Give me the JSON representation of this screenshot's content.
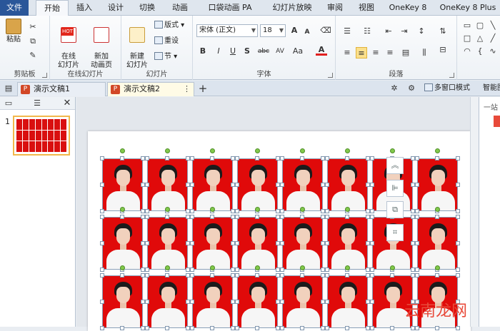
{
  "menu": {
    "tabs": [
      "文件",
      "开始",
      "插入",
      "设计",
      "切换",
      "动画",
      "口袋动画 PA",
      "幻灯片放映",
      "审阅",
      "视图",
      "OneKey 8",
      "OneKey 8 Plus"
    ]
  },
  "ribbon": {
    "clipboard": {
      "paste": "粘贴",
      "label": "剪贴板"
    },
    "online": {
      "online_slides": "在线\n幻灯片",
      "new_anim_page": "新加\n动画页",
      "label": "在线幻灯片",
      "hot": "HOT"
    },
    "slides": {
      "new_slide": "新建\n幻灯片",
      "layout": "版式",
      "reset": "重设",
      "section": "节",
      "label": "幻灯片"
    },
    "font": {
      "family": "宋体 (正文)",
      "size": "18",
      "label": "字体",
      "bold": "B",
      "italic": "I",
      "underline": "U",
      "shadow": "S",
      "strike": "abc",
      "spacing": "AV",
      "case": "Aa",
      "color": "A",
      "grow": "A",
      "shrink": "A"
    },
    "paragraph": {
      "label": "段落"
    }
  },
  "doc_tabs": [
    {
      "name": "演示文稿1",
      "badge": "P"
    },
    {
      "name": "演示文稿2",
      "badge": "P"
    }
  ],
  "right_toolbar": {
    "multi_window": "多窗口模式",
    "smart": "智能图"
  },
  "left_panel": {
    "slide_number": "1"
  },
  "slide": {
    "rows": 3,
    "cols": 8
  },
  "watermark": "云南龙网",
  "colors": {
    "file_tab": "#2a5699",
    "photo_bg": "#e00a0a",
    "selection": "#f2b84b"
  }
}
